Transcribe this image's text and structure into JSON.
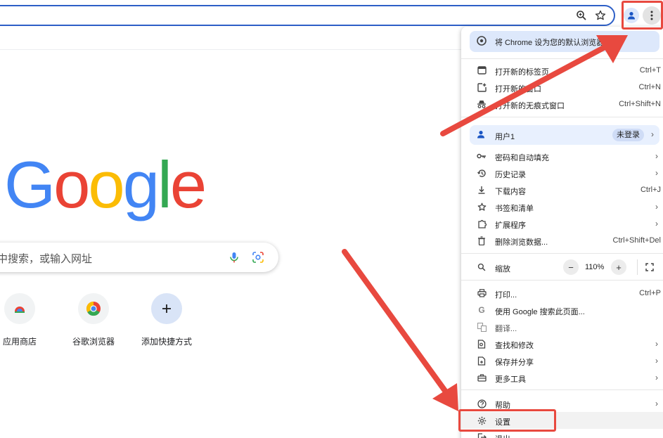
{
  "browser": {
    "omnibox_value": "",
    "accent_color": "#2d5fc7",
    "annotation_color": "#e8493f"
  },
  "google": {
    "logo": [
      "G",
      "o",
      "o",
      "g",
      "l",
      "e"
    ],
    "logo_colors": [
      "#4285f4",
      "#ea4335",
      "#fbbc05",
      "#4285f4",
      "#34a853",
      "#ea4335"
    ],
    "search_placeholder": "中搜索，或输入网址",
    "shortcuts": [
      {
        "label": "应用商店",
        "icon": "web-store-icon"
      },
      {
        "label": "谷歌浏览器",
        "icon": "chrome-icon"
      },
      {
        "label": "添加快捷方式",
        "icon": "plus-icon"
      }
    ]
  },
  "menu": {
    "banner": "将 Chrome 设为您的默认浏览器",
    "items": [
      {
        "label": "打开新的标签页",
        "shortcut": "Ctrl+T",
        "icon": "new-tab-icon"
      },
      {
        "label": "打开新的窗口",
        "shortcut": "Ctrl+N",
        "icon": "new-window-icon"
      },
      {
        "label": "打开新的无痕式窗口",
        "shortcut": "Ctrl+Shift+N",
        "icon": "incognito-icon"
      },
      {
        "label": "用户1",
        "badge": "未登录",
        "icon": "person-icon"
      },
      {
        "label": "密码和自动填充",
        "icon": "key-icon"
      },
      {
        "label": "历史记录",
        "icon": "history-icon"
      },
      {
        "label": "下载内容",
        "shortcut": "Ctrl+J",
        "icon": "download-icon"
      },
      {
        "label": "书签和清单",
        "icon": "star-icon"
      },
      {
        "label": "扩展程序",
        "icon": "puzzle-icon"
      },
      {
        "label": "删除浏览数据...",
        "shortcut": "Ctrl+Shift+Del",
        "icon": "trash-icon"
      },
      {
        "label": "缩放",
        "icon": "zoom-icon"
      },
      {
        "label": "打印...",
        "shortcut": "Ctrl+P",
        "icon": "print-icon"
      },
      {
        "label": "使用 Google 搜索此页面...",
        "icon": "google-g-icon"
      },
      {
        "label": "翻译...",
        "icon": "translate-icon"
      },
      {
        "label": "查找和修改",
        "icon": "find-icon"
      },
      {
        "label": "保存并分享",
        "icon": "save-share-icon"
      },
      {
        "label": "更多工具",
        "icon": "toolbox-icon"
      },
      {
        "label": "帮助",
        "icon": "help-icon"
      },
      {
        "label": "设置",
        "icon": "gear-icon"
      },
      {
        "label": "退出",
        "icon": "exit-icon"
      }
    ],
    "zoom": {
      "minus": "−",
      "value": "110%",
      "plus": "+"
    }
  }
}
